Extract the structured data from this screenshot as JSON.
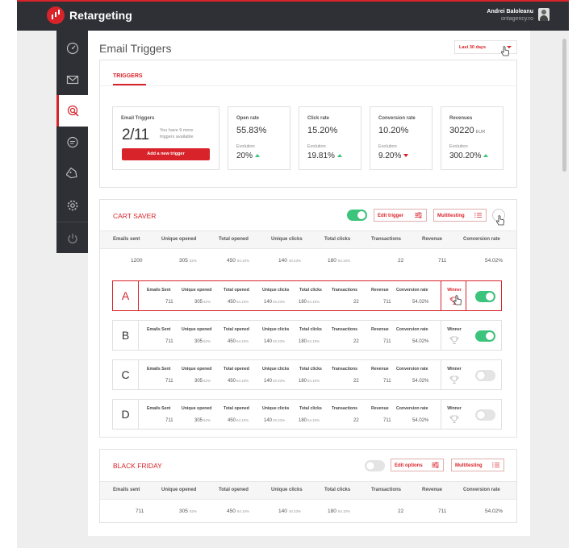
{
  "app": {
    "logo_text": "Retargeting"
  },
  "user": {
    "name": "Andrei Baloleanu",
    "org": "ontagency.ro"
  },
  "sidebar": {
    "items": [
      "dashboard-icon",
      "mail-icon",
      "target-icon",
      "chat-icon",
      "tag-icon",
      "settings-icon",
      "power-icon"
    ],
    "active": "target-icon"
  },
  "page": {
    "title": "Email Triggers",
    "range": "Last 30 days"
  },
  "tabs": {
    "active": "TRIGGERS"
  },
  "summary": {
    "email_triggers": {
      "label": "Email Triggers",
      "count": "2/11",
      "note": "You have 9 more triggers available",
      "add_label": "Add a new trigger"
    },
    "stats": [
      {
        "label": "Open rate",
        "value": "55.83%",
        "unit": "",
        "evo_label": "Evolution",
        "evo": "20%",
        "trend": "up"
      },
      {
        "label": "Click rate",
        "value": "15.20%",
        "unit": "",
        "evo_label": "Evolution",
        "evo": "19.81%",
        "trend": "up"
      },
      {
        "label": "Conversion rate",
        "value": "10.20%",
        "unit": "",
        "evo_label": "Evolution",
        "evo": "9.20%",
        "trend": "down"
      },
      {
        "label": "Revenues",
        "value": "30220",
        "unit": "EUR",
        "evo_label": "Evolution",
        "evo": "300.20%",
        "trend": "up"
      }
    ]
  },
  "cart_saver": {
    "title": "CART SAVER",
    "enabled": true,
    "edit_label": "Edit trigger",
    "multitesting_label": "Multitesting",
    "headers": [
      "Emails sent",
      "Unique opened",
      "Total opened",
      "Unique clicks",
      "Total clicks",
      "Transactions",
      "Revenue",
      "Conversion rate"
    ],
    "totals": {
      "emails_sent": "1200",
      "unique_opened": "305",
      "unique_opened_pct": "52%",
      "total_opened": "450",
      "total_opened_pct": "64.10%",
      "unique_clicks": "140",
      "unique_clicks_pct": "40.23%",
      "total_clicks": "180",
      "total_clicks_pct": "54.10%",
      "transactions": "22",
      "revenue": "711",
      "conversion_rate": "54.02%"
    },
    "variant_headers": [
      "Emails Sent",
      "Unique opened",
      "Total opened",
      "Unique clicks",
      "Total clicks",
      "Transactions",
      "Revenue",
      "Conversion rate"
    ],
    "winner_label": "Winner",
    "variants": [
      {
        "letter": "A",
        "emails_sent": "711",
        "unique_opened": "305",
        "unique_opened_pct": "52%",
        "total_opened": "450",
        "total_opened_pct": "64.10%",
        "unique_clicks": "140",
        "unique_clicks_pct": "40.23%",
        "total_clicks": "180",
        "total_clicks_pct": "54.10%",
        "transactions": "22",
        "revenue": "711",
        "conversion_rate": "54.02%",
        "enabled": true,
        "selected": true
      },
      {
        "letter": "B",
        "emails_sent": "711",
        "unique_opened": "305",
        "unique_opened_pct": "52%",
        "total_opened": "450",
        "total_opened_pct": "64.10%",
        "unique_clicks": "140",
        "unique_clicks_pct": "40.23%",
        "total_clicks": "180",
        "total_clicks_pct": "54.10%",
        "transactions": "22",
        "revenue": "711",
        "conversion_rate": "54.02%",
        "enabled": true,
        "selected": false
      },
      {
        "letter": "C",
        "emails_sent": "711",
        "unique_opened": "305",
        "unique_opened_pct": "52%",
        "total_opened": "450",
        "total_opened_pct": "64.10%",
        "unique_clicks": "140",
        "unique_clicks_pct": "40.23%",
        "total_clicks": "180",
        "total_clicks_pct": "54.10%",
        "transactions": "22",
        "revenue": "711",
        "conversion_rate": "54.02%",
        "enabled": false,
        "selected": false
      },
      {
        "letter": "D",
        "emails_sent": "711",
        "unique_opened": "305",
        "unique_opened_pct": "52%",
        "total_opened": "450",
        "total_opened_pct": "64.10%",
        "unique_clicks": "140",
        "unique_clicks_pct": "40.23%",
        "total_clicks": "180",
        "total_clicks_pct": "54.10%",
        "transactions": "22",
        "revenue": "711",
        "conversion_rate": "54.02%",
        "enabled": false,
        "selected": false
      }
    ]
  },
  "black_friday": {
    "title": "BLACK FRIDAY",
    "enabled": false,
    "edit_label": "Edit options",
    "multitesting_label": "Multitesting",
    "headers": [
      "Emails sent",
      "Unique opened",
      "Total opened",
      "Unique clicks",
      "Total clicks",
      "Transactions",
      "Revenue",
      "Conversion rate"
    ],
    "totals": {
      "emails_sent": "711",
      "unique_opened": "305",
      "unique_opened_pct": "52%",
      "total_opened": "450",
      "total_opened_pct": "64.10%",
      "unique_clicks": "140",
      "unique_clicks_pct": "40.23%",
      "total_clicks": "180",
      "total_clicks_pct": "54.10%",
      "transactions": "22",
      "revenue": "711",
      "conversion_rate": "54.02%"
    }
  },
  "colors": {
    "accent": "#d8232a",
    "sidebar": "#2e3035",
    "toggle_on": "#3cc47c",
    "trend_up": "#3cc47c",
    "trend_down": "#d8232a"
  }
}
